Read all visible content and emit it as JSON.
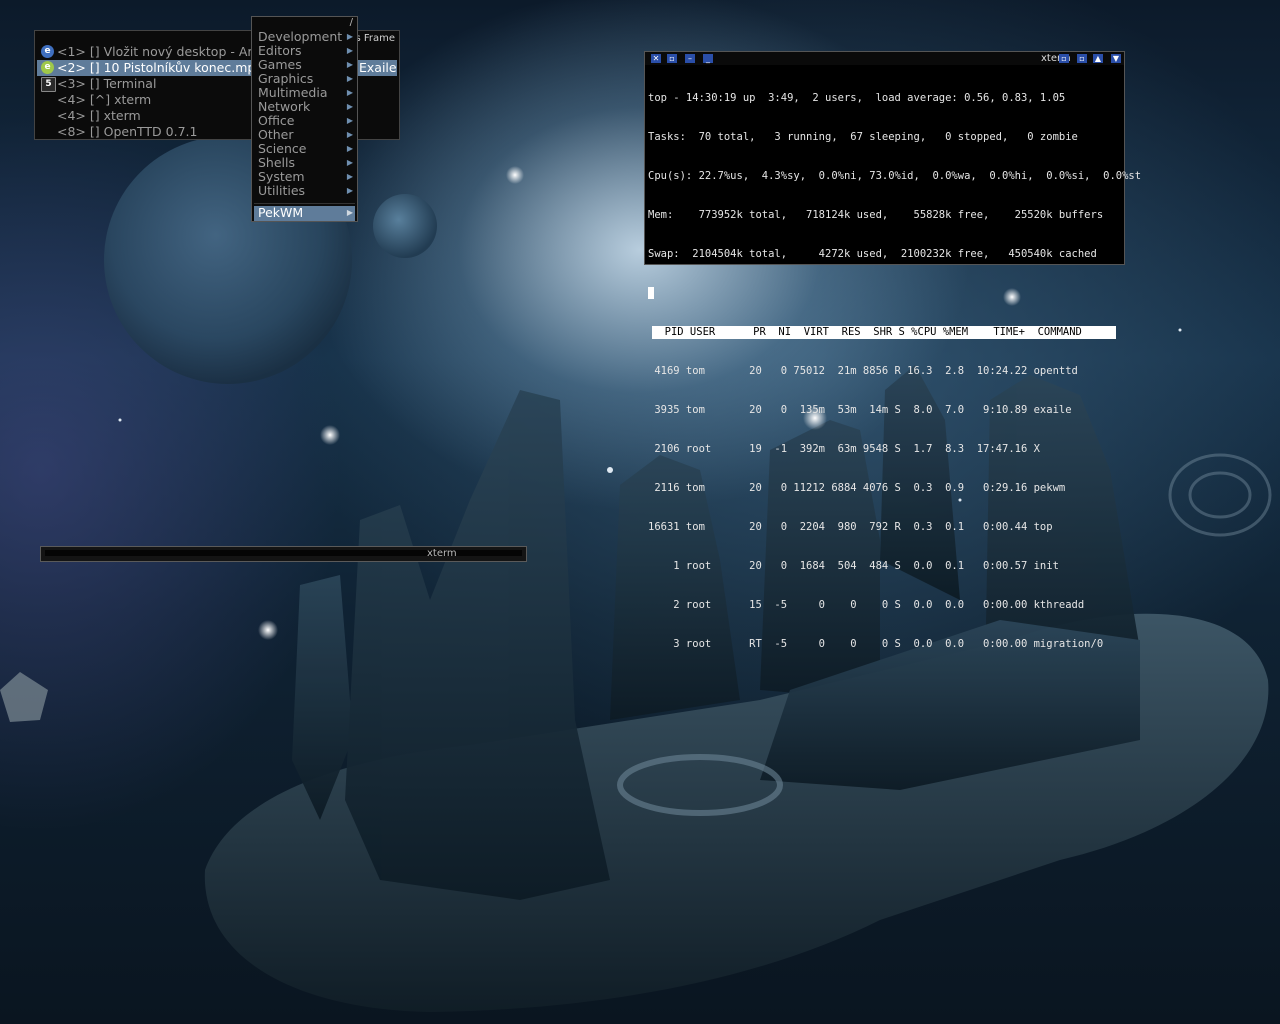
{
  "window_list": {
    "frame_label": "s Frame",
    "items": [
      {
        "label": "<1> [] Vložit nový desktop - Arc",
        "icon": "browser-icon",
        "extra": ""
      },
      {
        "label": "<2> [] 10 Pistolníkův konec.mp",
        "icon": "media-player-icon",
        "extra": "Exaile"
      },
      {
        "label": "<3> [] Terminal",
        "icon": "terminal-icon",
        "extra": ""
      },
      {
        "label": "<4> [^] xterm",
        "icon": "",
        "extra": ""
      },
      {
        "label": "<4> [] xterm",
        "icon": "",
        "extra": ""
      },
      {
        "label": "<8> [] OpenTTD 0.7.1",
        "icon": "",
        "extra": ""
      }
    ],
    "icon_glyphs": {
      "browser": "e",
      "media": "e",
      "terminal": "5"
    }
  },
  "root_menu": {
    "title": "/",
    "items": [
      "Development",
      "Editors",
      "Games",
      "Graphics",
      "Multimedia",
      "Network",
      "Office",
      "Other",
      "Science",
      "Shells",
      "System",
      "Utilities"
    ],
    "bottom_item": "PekWM",
    "arrow": "▶"
  },
  "xterm_top": {
    "title": "xterm",
    "buttons_left": [
      "✕",
      "▫",
      "–",
      "_"
    ],
    "buttons_right": [
      "▫",
      "▫",
      "▲",
      "▼"
    ],
    "summary": [
      "top - 14:30:19 up  3:49,  2 users,  load average: 0.56, 0.83, 1.05",
      "Tasks:  70 total,   3 running,  67 sleeping,   0 stopped,   0 zombie",
      "Cpu(s): 22.7%us,  4.3%sy,  0.0%ni, 73.0%id,  0.0%wa,  0.0%hi,  0.0%si,  0.0%st",
      "Mem:    773952k total,   718124k used,    55828k free,    25520k buffers",
      "Swap:  2104504k total,     4272k used,  2100232k free,   450540k cached"
    ],
    "header": "  PID USER      PR  NI  VIRT  RES  SHR S %CPU %MEM    TIME+  COMMAND",
    "processes": [
      " 4169 tom       20   0 75012  21m 8856 R 16.3  2.8  10:24.22 openttd",
      " 3935 tom       20   0  135m  53m  14m S  8.0  7.0   9:10.89 exaile",
      " 2106 root      19  -1  392m  63m 9548 S  1.7  8.3  17:47.16 X",
      " 2116 tom       20   0 11212 6884 4076 S  0.3  0.9   0:29.16 pekwm",
      "16631 tom       20   0  2204  980  792 R  0.3  0.1   0:00.44 top",
      "    1 root      20   0  1684  504  484 S  0.0  0.1   0:00.57 init",
      "    2 root      15  -5     0    0    0 S  0.0  0.0   0:00.00 kthreadd",
      "    3 root      RT  -5     0    0    0 S  0.0  0.0   0:00.00 migration/0"
    ]
  },
  "xterm_small": {
    "title": "xterm"
  },
  "colors": {
    "menu_bg": "#0b0b0b",
    "selection": "#5f7c9a",
    "button_blue": "#2a4ea8"
  }
}
